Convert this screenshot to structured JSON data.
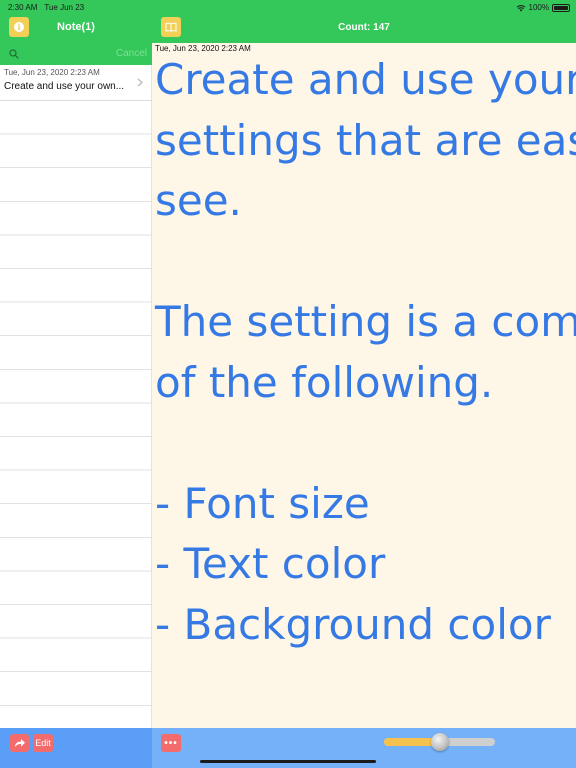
{
  "status_bar": {
    "time": "2:30 AM",
    "date": "Tue Jun 23",
    "battery": "100%"
  },
  "sidebar": {
    "title": "Note(1)",
    "search": {
      "value": "",
      "placeholder": "",
      "cancel_label": "Cancel"
    },
    "notes": [
      {
        "date": "Tue, Jun 23, 2020 2:23 AM",
        "preview": "Create and use your own..."
      }
    ],
    "footer": {
      "edit_label": "Edit"
    }
  },
  "main": {
    "count_label": "Count: 147",
    "note_date": "Tue, Jun 23, 2020 2:23 AM",
    "note_text": "Create and use your own\nsettings that are easy to\nsee.\n\nThe setting is a combination\nof the following.\n\n- Font size\n- Text color\n- Background color",
    "text_color": "#3579e5",
    "background_color": "#fef6e6",
    "font_size_slider": 0.5
  },
  "colors": {
    "header": "#34c759",
    "sidebar_footer": "#5b9ef7",
    "main_footer": "#74b1f8",
    "button_yellow": "#f2cf57",
    "button_red": "#f36b6b"
  },
  "icons": {
    "info": "info-icon",
    "book": "book-icon",
    "search": "search-icon",
    "share": "share-icon",
    "more": "more-icon",
    "chevron": "chevron-right-icon"
  }
}
